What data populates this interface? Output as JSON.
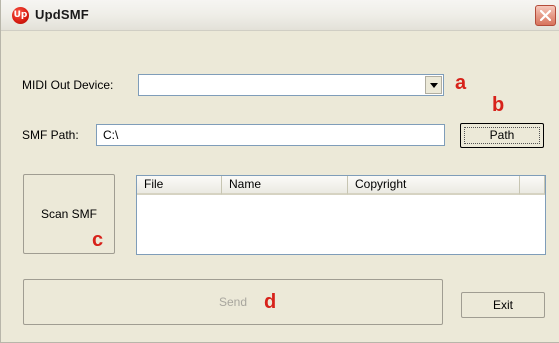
{
  "window": {
    "title": "UpdSMF",
    "icon_text": "Up",
    "icon": "app-logo-icon",
    "close_icon": "close-icon"
  },
  "midi": {
    "label": "MIDI Out Device:",
    "selected": "",
    "dropdown_icon": "chevron-down-icon"
  },
  "smf_path": {
    "label": "SMF Path:",
    "value": "C:\\"
  },
  "buttons": {
    "path": "Path",
    "scan": "Scan SMF",
    "send": "Send",
    "exit": "Exit"
  },
  "list": {
    "columns": [
      "File",
      "Name",
      "Copyright",
      ""
    ],
    "rows": []
  },
  "annotations": {
    "a": "a",
    "b": "b",
    "c": "c",
    "d": "d",
    "color": "#d7221a"
  },
  "colors": {
    "window_bg": "#ece9d8",
    "field_border": "#7f9db9",
    "disabled_text": "#a8a69e"
  }
}
